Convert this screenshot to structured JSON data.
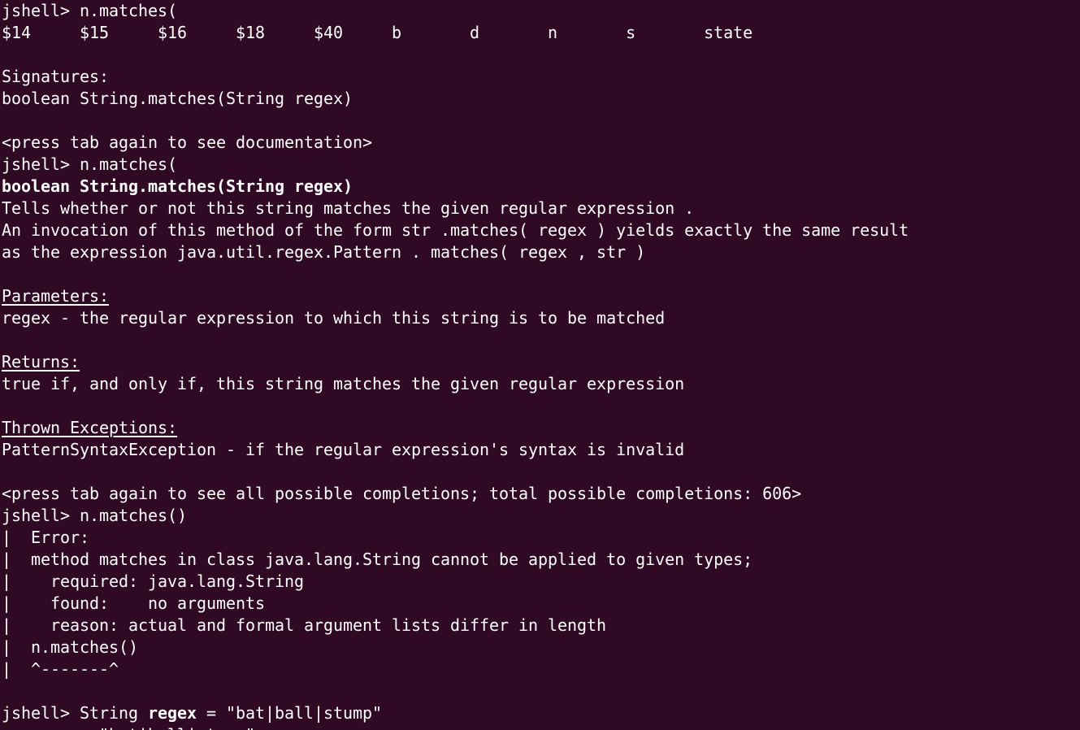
{
  "terminal": {
    "background": "#300a24",
    "foreground": "#ffffff",
    "lines": [
      {
        "text": "jshell> n.matches("
      },
      {
        "text": "$14     $15     $16     $18     $40     b       d       n       s       state"
      },
      {
        "text": ""
      },
      {
        "text": "Signatures:"
      },
      {
        "text": "boolean String.matches(String regex)"
      },
      {
        "text": ""
      },
      {
        "text": "<press tab again to see documentation>"
      },
      {
        "text": "jshell> n.matches("
      },
      {
        "text": "boolean String.matches(String regex)",
        "style": "bold"
      },
      {
        "text": "Tells whether or not this string matches the given regular expression ."
      },
      {
        "text": "An invocation of this method of the form str .matches( regex ) yields exactly the same result"
      },
      {
        "text": "as the expression java.util.regex.Pattern . matches( regex , str )"
      },
      {
        "text": ""
      },
      {
        "text": "Parameters:",
        "style": "underline"
      },
      {
        "text": "regex - the regular expression to which this string is to be matched"
      },
      {
        "text": ""
      },
      {
        "text": "Returns:",
        "style": "underline"
      },
      {
        "text": "true if, and only if, this string matches the given regular expression"
      },
      {
        "text": ""
      },
      {
        "text": "Thrown Exceptions:",
        "style": "underline"
      },
      {
        "text": "PatternSyntaxException - if the regular expression's syntax is invalid"
      },
      {
        "text": ""
      },
      {
        "text": "<press tab again to see all possible completions; total possible completions: 606>"
      },
      {
        "text": "jshell> n.matches()"
      },
      {
        "text": "|  Error:"
      },
      {
        "text": "|  method matches in class java.lang.String cannot be applied to given types;"
      },
      {
        "text": "|    required: java.lang.String"
      },
      {
        "text": "|    found:    no arguments"
      },
      {
        "text": "|    reason: actual and formal argument lists differ in length"
      },
      {
        "text": "|  n.matches()"
      },
      {
        "text": "|  ^-------^"
      },
      {
        "text": ""
      },
      {
        "segments": [
          {
            "text": "jshell> String "
          },
          {
            "text": "regex",
            "style": "bold"
          },
          {
            "text": " = \"bat|ball|stump\""
          }
        ]
      },
      {
        "text": "regex ==> \"bat|ball|stump\""
      }
    ]
  }
}
